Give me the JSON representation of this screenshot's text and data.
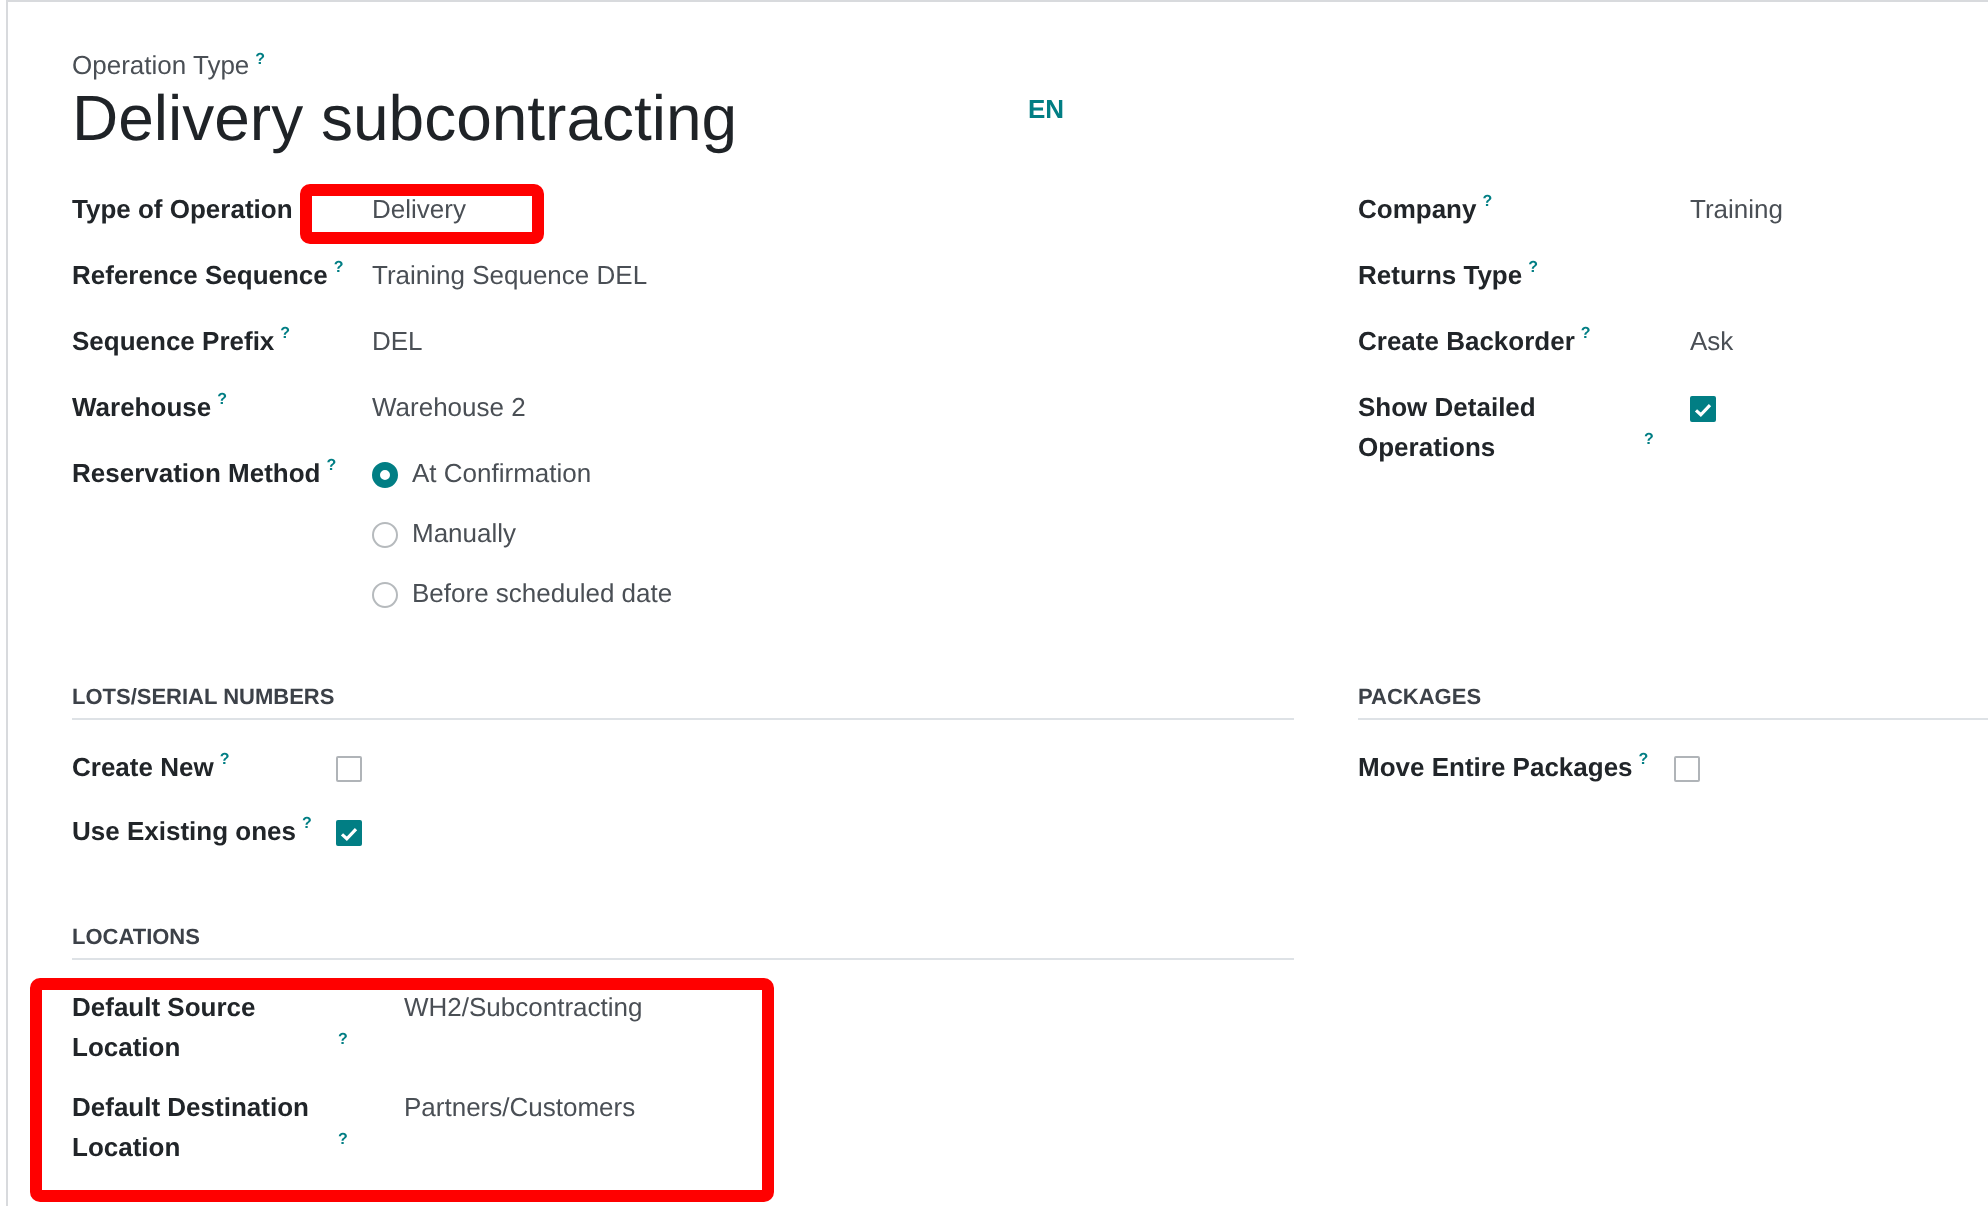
{
  "header": {
    "label": "Operation Type",
    "help": "?",
    "title": "Delivery subcontracting",
    "language": "EN"
  },
  "left_fields": [
    {
      "kind": "text",
      "label": "Type of Operation",
      "value": "Delivery"
    },
    {
      "kind": "text",
      "label": "Reference Sequence",
      "help": "?",
      "value": "Training Sequence DEL"
    },
    {
      "kind": "text",
      "label": "Sequence Prefix",
      "help": "?",
      "value": "DEL"
    },
    {
      "kind": "text",
      "label": "Warehouse",
      "help": "?",
      "value": "Warehouse 2"
    },
    {
      "kind": "radio",
      "label": "Reservation Method",
      "help": "?",
      "options": [
        {
          "label": "At Confirmation",
          "selected": true
        },
        {
          "label": "Manually",
          "selected": false
        },
        {
          "label": "Before scheduled date",
          "selected": false
        }
      ]
    }
  ],
  "right_fields": [
    {
      "kind": "text",
      "label": "Company",
      "help": "?",
      "value": "Training"
    },
    {
      "kind": "text",
      "label": "Returns Type",
      "help": "?"
    },
    {
      "kind": "text",
      "label": "Create Backorder",
      "help": "?",
      "value": "Ask"
    },
    {
      "kind": "checkbox",
      "label": "Show Detailed Operations",
      "help": "?",
      "checked": true
    }
  ],
  "sections": [
    {
      "title": "LOTS/SERIAL NUMBERS",
      "fields": [
        {
          "kind": "checkbox",
          "label": "Create New",
          "help": "?",
          "checked": false
        },
        {
          "kind": "checkbox",
          "label": "Use Existing ones",
          "help": "?",
          "checked": true
        }
      ]
    },
    {
      "title": "PACKAGES",
      "fields": [
        {
          "kind": "checkbox",
          "label": "Move Entire Packages",
          "help": "?",
          "checked": false
        }
      ]
    },
    {
      "title": "LOCATIONS",
      "fields": [
        {
          "kind": "text",
          "label": "Default Source Location",
          "help": "?",
          "value": "WH2/Subcontracting"
        },
        {
          "kind": "text",
          "label": "Default Destination Location",
          "help": "?",
          "value": "Partners/Customers"
        }
      ]
    }
  ]
}
